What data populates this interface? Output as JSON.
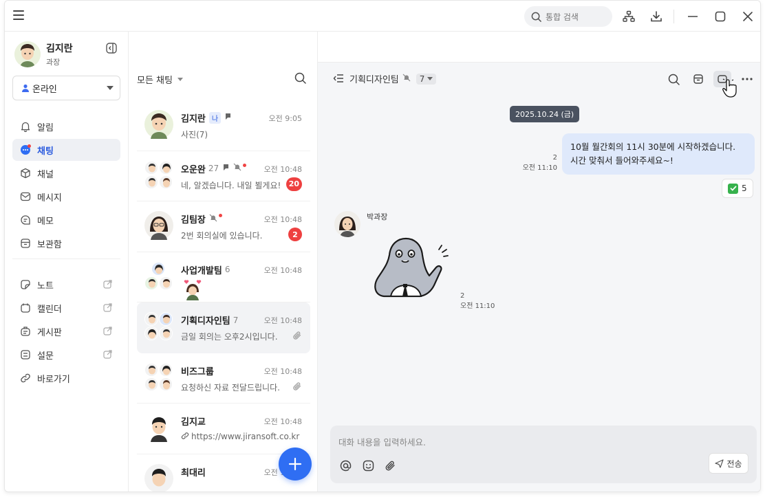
{
  "header": {
    "search_placeholder": "통합 검색",
    "icons": [
      "menu-icon",
      "org-chart-icon",
      "download-icon",
      "minimize-icon",
      "maximize-icon",
      "close-icon"
    ]
  },
  "profile": {
    "name": "김지란",
    "role": "과장",
    "status": "온라인",
    "status_color": "#3d6bf0"
  },
  "nav": {
    "items": [
      {
        "label": "알림",
        "icon": "bell-icon"
      },
      {
        "label": "채팅",
        "icon": "chat-icon"
      },
      {
        "label": "채널",
        "icon": "box-icon"
      },
      {
        "label": "메시지",
        "icon": "mail-icon"
      },
      {
        "label": "메모",
        "icon": "memo-icon"
      },
      {
        "label": "보관함",
        "icon": "archive-icon"
      }
    ],
    "external": [
      {
        "label": "노트",
        "icon": "note-icon"
      },
      {
        "label": "캘린더",
        "icon": "calendar-icon"
      },
      {
        "label": "게시판",
        "icon": "board-icon"
      },
      {
        "label": "설문",
        "icon": "survey-icon"
      },
      {
        "label": "바로가기",
        "icon": "link-icon"
      }
    ]
  },
  "chatlist": {
    "tab": "채팅",
    "filter": "모든 채팅",
    "rows": [
      {
        "name": "김지란",
        "me": "나",
        "count": "",
        "time": "오전 9:05",
        "preview": "사진(7)",
        "badge": ""
      },
      {
        "name": "오운완",
        "me": "",
        "count": "27",
        "time": "오전 10:48",
        "preview": "네, 알겠습니다. 내일 뵐게요!",
        "badge": "20"
      },
      {
        "name": "김팀장",
        "me": "",
        "count": "",
        "time": "오전 10:48",
        "preview": "2번 회의실에 있습니다.",
        "badge": "2"
      },
      {
        "name": "사업개발팀",
        "me": "",
        "count": "6",
        "time": "오전 10:48",
        "preview": "",
        "badge": ""
      },
      {
        "name": "기획디자인팀",
        "me": "",
        "count": "7",
        "time": "오전 10:48",
        "preview": "금일 회의는 오후2시입니다.",
        "badge": ""
      },
      {
        "name": "비즈그룹",
        "me": "",
        "count": "",
        "time": "오전 10:48",
        "preview": "요청하신 자료 전달드립니다.",
        "badge": ""
      },
      {
        "name": "김지교",
        "me": "",
        "count": "",
        "time": "오전 10:48",
        "preview": "https://www.jiransoft.co.kr",
        "badge": ""
      },
      {
        "name": "최대리",
        "me": "",
        "count": "",
        "time": "오전 10:48",
        "preview": "",
        "badge": ""
      }
    ]
  },
  "conversation": {
    "title": "기획디자인팀",
    "members": "7",
    "date": "2025.10.24 (금)",
    "my_message": {
      "line1": "10월 월간회의 11시 30분에 시작하겠습니다.",
      "line2": "시간 맞춰서 들어와주세요~!",
      "unread": "2",
      "time": "오전 11:10",
      "reaction_count": "5"
    },
    "other_message": {
      "sender": "박과장",
      "unread": "2",
      "time": "오전 11:10"
    },
    "composer": {
      "placeholder": "대화 내용을 입력하세요.",
      "send_label": "전송"
    }
  },
  "colors": {
    "accent": "#2b5bde",
    "fab": "#2f6ef3",
    "badge": "#ee4040",
    "my_bubble": "#dfe9fb"
  }
}
